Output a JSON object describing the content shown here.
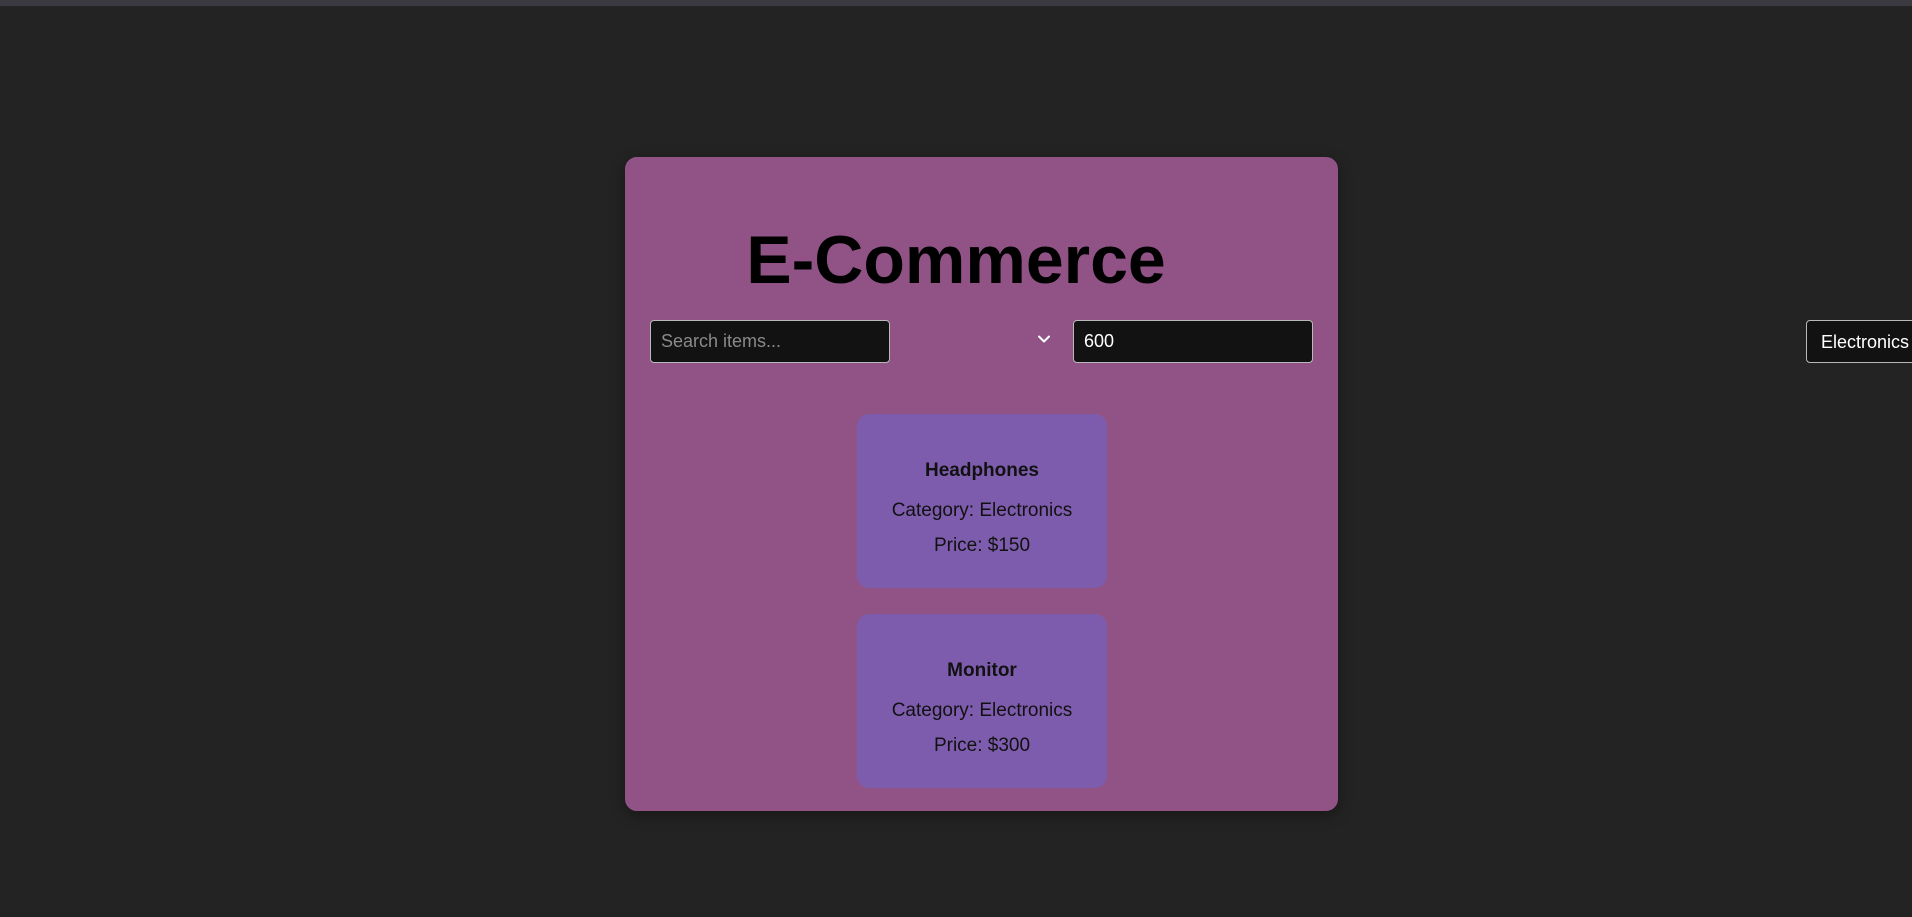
{
  "app": {
    "title": "E-Commerce"
  },
  "filters": {
    "search_placeholder": "Search items...",
    "search_value": "",
    "category_selected": "Electronics",
    "max_price_value": "600"
  },
  "products": [
    {
      "name": "Headphones",
      "category_text": "Category: Electronics",
      "price_text": "Price: $150"
    },
    {
      "name": "Monitor",
      "category_text": "Category: Electronics",
      "price_text": "Price: $300"
    }
  ],
  "colors": {
    "page_background": "#232323",
    "panel_background": "#915386",
    "card_background": "#7e5cad",
    "input_background": "#121212"
  },
  "icons": {
    "select_arrow": "chevron-down-icon"
  }
}
